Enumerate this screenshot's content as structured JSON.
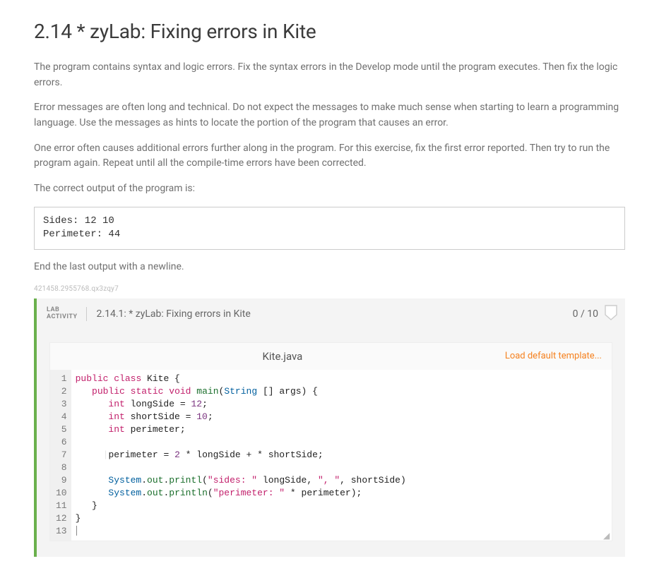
{
  "title": "2.14 * zyLab: Fixing errors in Kite",
  "paragraphs": {
    "p1": "The program contains syntax and logic errors. Fix the syntax errors in the Develop mode until the program executes. Then fix the logic errors.",
    "p2": "Error messages are often long and technical. Do not expect the messages to make much sense when starting to learn a programming language. Use the messages as hints to locate the portion of the program that causes an error.",
    "p3": "One error often causes additional errors further along in the program. For this exercise, fix the first error reported. Then try to run the program again. Repeat until all the compile-time errors have been corrected.",
    "p4": "The correct output of the program is:",
    "p5": "End the last output with a newline."
  },
  "expected_output": "Sides: 12 10\nPerimeter: 44",
  "watermark": "421458.2955768.qx3zqy7",
  "lab": {
    "tag_line1": "LAB",
    "tag_line2": "ACTIVITY",
    "title": "2.14.1: * zyLab: Fixing errors in Kite",
    "score": "0 / 10",
    "file_name": "Kite.java",
    "load_link": "Load default template...",
    "line_count": 13,
    "code": {
      "l1": {
        "pre": "",
        "tokens": [
          [
            "kw",
            "public"
          ],
          [
            "",
            " "
          ],
          [
            "kw",
            "class"
          ],
          [
            "",
            " Kite {"
          ]
        ]
      },
      "l2": {
        "pre": "   ",
        "tokens": [
          [
            "kw",
            "public"
          ],
          [
            "",
            " "
          ],
          [
            "kw",
            "static"
          ],
          [
            "",
            " "
          ],
          [
            "kw",
            "void"
          ],
          [
            "",
            " "
          ],
          [
            "ident",
            "main"
          ],
          [
            "",
            "("
          ],
          [
            "type",
            "String"
          ],
          [
            "",
            " [] args) {"
          ]
        ]
      },
      "l3": {
        "pre": "      ",
        "tokens": [
          [
            "kw",
            "int"
          ],
          [
            "",
            " longSide = "
          ],
          [
            "num",
            "12"
          ],
          [
            "",
            ";"
          ]
        ]
      },
      "l4": {
        "pre": "      ",
        "tokens": [
          [
            "kw",
            "int"
          ],
          [
            "",
            " shortSide = "
          ],
          [
            "num",
            "10"
          ],
          [
            "",
            ";"
          ]
        ]
      },
      "l5": {
        "pre": "      ",
        "tokens": [
          [
            "kw",
            "int"
          ],
          [
            "",
            " perimeter;"
          ]
        ]
      },
      "l6": {
        "pre": "",
        "tokens": [
          [
            "",
            ""
          ]
        ]
      },
      "l7": {
        "pre": "      ",
        "guide": true,
        "tokens": [
          [
            "",
            "perimeter = "
          ],
          [
            "num",
            "2"
          ],
          [
            "",
            " * longSide + * shortSide;"
          ]
        ]
      },
      "l8": {
        "pre": "",
        "tokens": [
          [
            "",
            ""
          ]
        ]
      },
      "l9": {
        "pre": "      ",
        "tokens": [
          [
            "type",
            "System"
          ],
          [
            "",
            "."
          ],
          [
            "ident",
            "out"
          ],
          [
            "",
            "."
          ],
          [
            "ident",
            "printl"
          ],
          [
            "",
            "("
          ],
          [
            "str",
            "\"sides: \""
          ],
          [
            "",
            " longSide, "
          ],
          [
            "str",
            "\", \""
          ],
          [
            "",
            ", shortSide)"
          ]
        ]
      },
      "l10": {
        "pre": "      ",
        "tokens": [
          [
            "type",
            "System"
          ],
          [
            "",
            "."
          ],
          [
            "ident",
            "out"
          ],
          [
            "",
            "."
          ],
          [
            "ident",
            "println"
          ],
          [
            "",
            "("
          ],
          [
            "str",
            "\"perimeter: \""
          ],
          [
            "",
            " * perimeter);"
          ]
        ]
      },
      "l11": {
        "pre": "   ",
        "tokens": [
          [
            "",
            "}"
          ]
        ]
      },
      "l12": {
        "pre": "",
        "tokens": [
          [
            "",
            "}"
          ]
        ]
      },
      "l13": {
        "pre": "",
        "tokens": [
          [
            "",
            ""
          ]
        ],
        "cursor": true
      }
    }
  }
}
